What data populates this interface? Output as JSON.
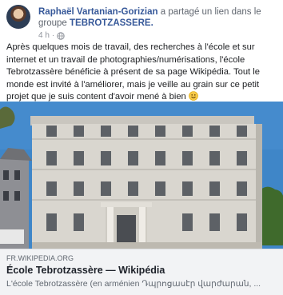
{
  "post": {
    "author": "Raphaël Vartanian-Gorizian",
    "action": " a partagé un lien dans le groupe ",
    "group": "TEBROTZASSERE.",
    "time": "4 h",
    "privacy_icon": "globe-icon",
    "text_main": "Après quelques mois de travail, des recherches à l'école et sur internet et un travail de photographies/numérisations, l'école Tebrotzassère bénéficie à présent de sa page Wikipédia. Tout le monde est invité à l'améliorer, mais je veille au grain sur ce petit projet que je suis content d'avoir mené à bien ",
    "emoji_icon": "smiley-icon"
  },
  "link": {
    "domain": "FR.WIKIPEDIA.ORG",
    "title": "École Tebrotzassère — Wikipédia",
    "description": "L'école Tebrotzassère (en arménien Դպրոցասէր վարժարան, ..."
  },
  "colors": {
    "link_blue": "#365899",
    "meta_gray": "#90949c",
    "card_bg": "#f2f3f5",
    "sky": "#3f86c8",
    "facade": "#d9d6cf"
  }
}
